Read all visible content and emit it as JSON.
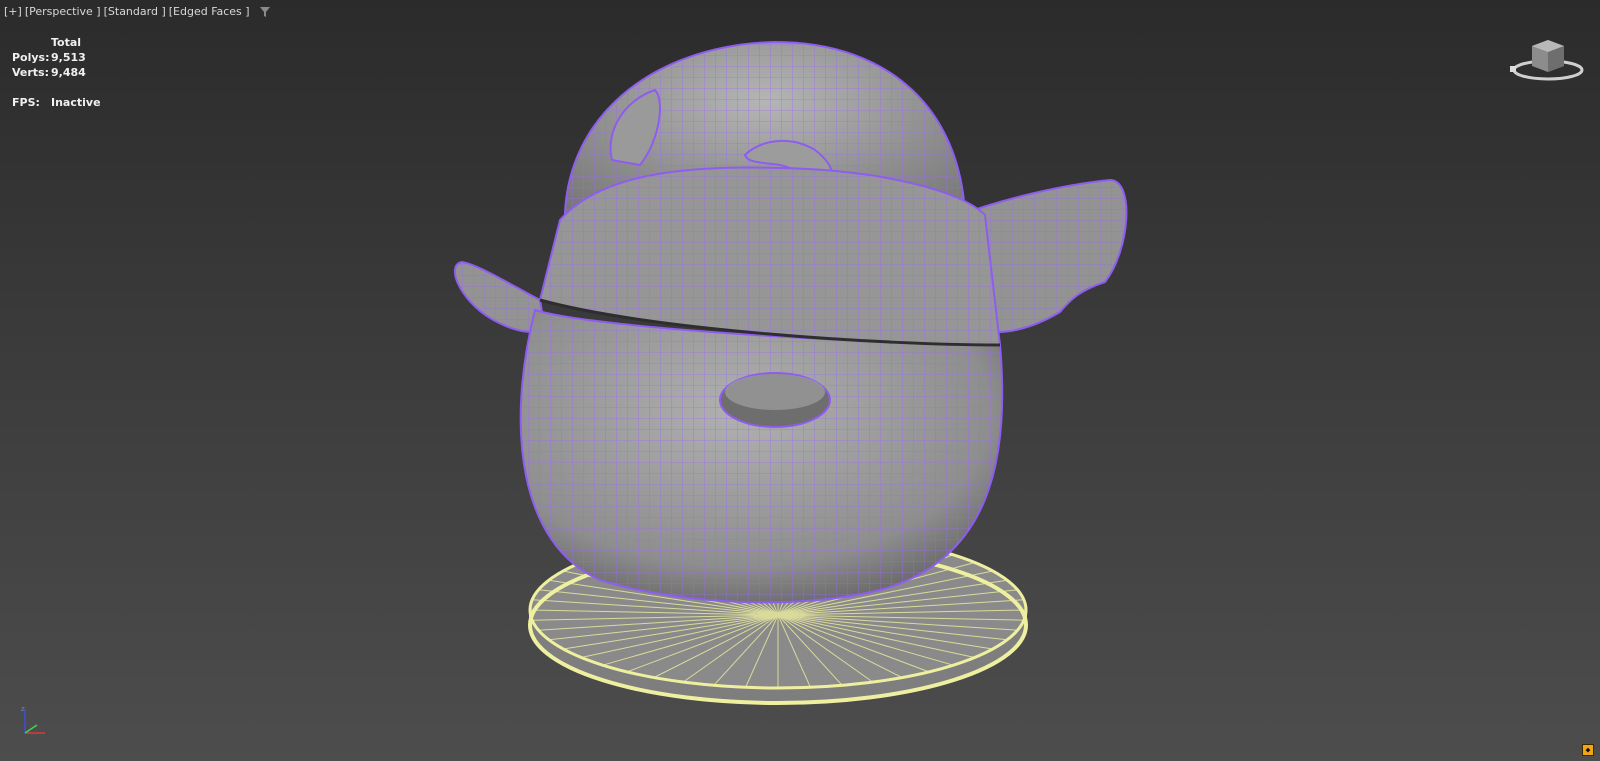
{
  "viewport": {
    "labels": [
      "[+]",
      "[Perspective ]",
      "[Standard ]",
      "[Edged Faces ]"
    ],
    "filter_icon": "filter-icon"
  },
  "stats": {
    "header": "Total",
    "polys_label": "Polys:",
    "polys_value": "9,513",
    "verts_label": "Verts:",
    "verts_value": "9,484",
    "fps_label": "FPS:",
    "fps_value": "Inactive"
  },
  "colors": {
    "wire_purple": "#8f5cf0",
    "mesh_gray": "#9a9a9a",
    "selected_yellow": "#eef0a0",
    "badge_orange": "#f2a516"
  },
  "icons": {
    "viewcube": "viewcube-icon",
    "axis": "axis-tripod-icon",
    "badge": "viewport-badge-icon"
  }
}
